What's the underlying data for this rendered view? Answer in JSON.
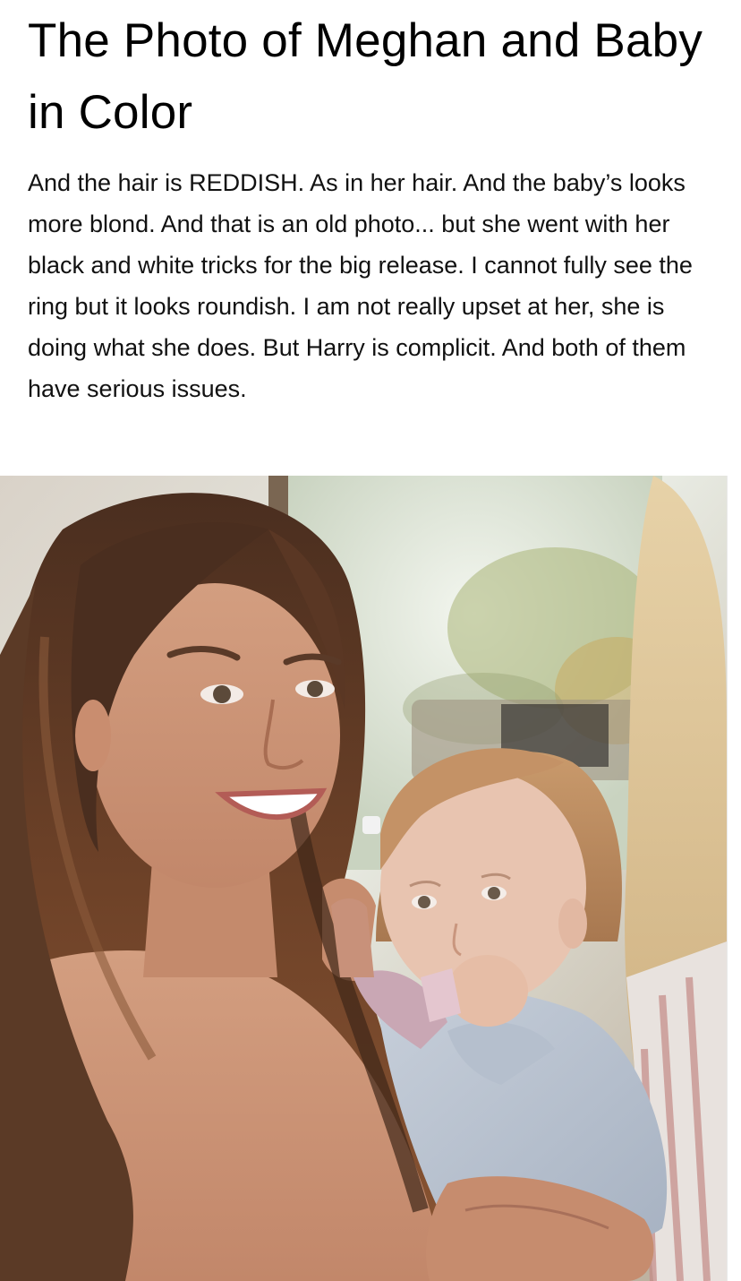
{
  "post": {
    "title": "The Photo of Meghan and Baby in Color",
    "body": "And the hair is REDDISH. As in her hair. And the baby’s looks more blond. And that is an old photo... but she went with her black and white tricks for the big release. I cannot fully see the ring but it looks roundish. I am not really upset at her, she is doing what she does. But Harry is complicit. And both of them have serious issues."
  },
  "colors": {
    "background": "#ffffff",
    "title_text": "#000000",
    "body_text": "#111111"
  }
}
